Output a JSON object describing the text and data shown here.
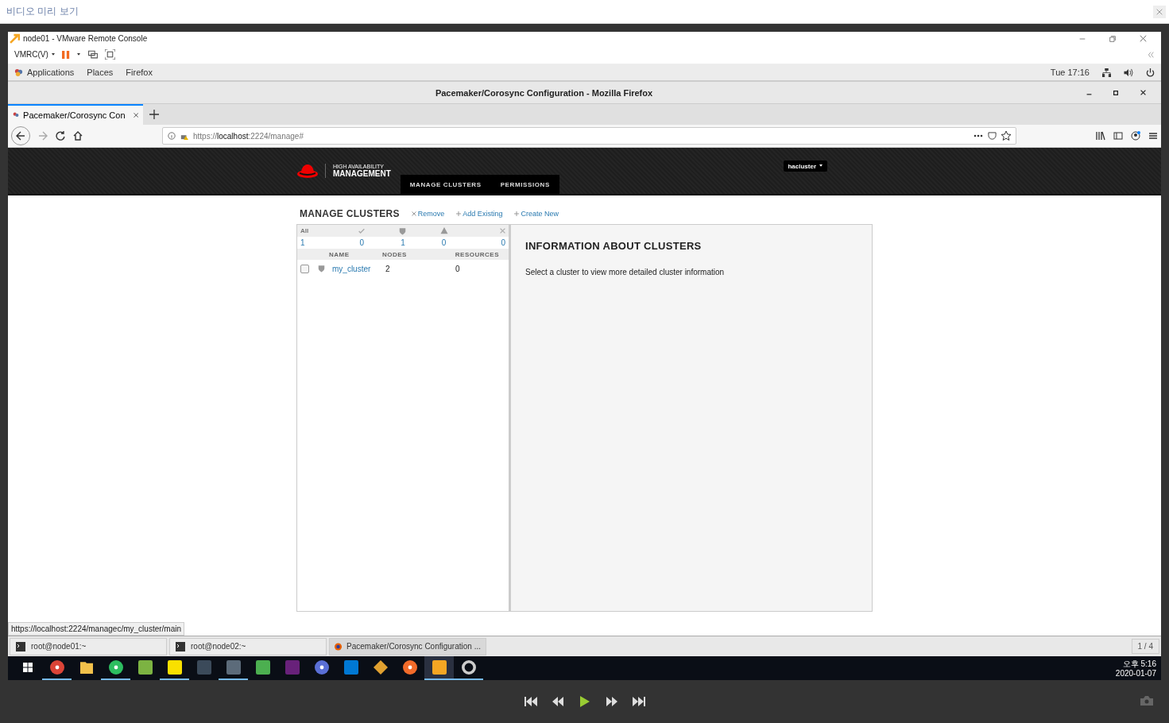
{
  "preview": {
    "title": "비디오 미리 보기"
  },
  "vmrc": {
    "title": "node01 - VMware Remote Console",
    "menu": "VMRC(V)",
    "paused": true
  },
  "gnome": {
    "menus": [
      "Applications",
      "Places",
      "Firefox"
    ],
    "clock": "Tue 17:16"
  },
  "firefox": {
    "title": "Pacemaker/Corosync Configuration - Mozilla Firefox",
    "tabs": [
      {
        "label": "Pacemaker/Corosync Con",
        "selected": true
      }
    ],
    "url": {
      "scheme": "https://",
      "host": "localhost",
      "rest": ":2224/manage#"
    }
  },
  "app": {
    "brand_top": "HIGH AVAILABILITY",
    "brand_bottom": "MANAGEMENT",
    "nav": [
      {
        "label": "MANAGE CLUSTERS",
        "selected": false
      },
      {
        "label": "PERMISSIONS",
        "selected": false
      }
    ],
    "user": "hacluster",
    "heading": "MANAGE CLUSTERS",
    "actions": [
      {
        "kind": "remove",
        "label": "Remove"
      },
      {
        "kind": "add",
        "label": "Add Existing"
      },
      {
        "kind": "add",
        "label": "Create New"
      }
    ],
    "filters": [
      {
        "kind": "all",
        "label": "All",
        "count": "1"
      },
      {
        "kind": "ok",
        "count": "0"
      },
      {
        "kind": "shield",
        "count": "1"
      },
      {
        "kind": "warning",
        "count": "0"
      },
      {
        "kind": "error",
        "count": "0"
      }
    ],
    "columns": [
      "NAME",
      "NODES",
      "RESOURCES"
    ],
    "rows": [
      {
        "checked": false,
        "name": "my_cluster",
        "nodes": "2",
        "resources": "0"
      }
    ],
    "info_title": "INFORMATION ABOUT CLUSTERS",
    "info_text": "Select a cluster to view more detailed cluster information"
  },
  "status_url": "https://localhost:2224/managec/my_cluster/main",
  "window_list": {
    "items": [
      {
        "kind": "terminal",
        "label": "root@node01:~",
        "selected": false
      },
      {
        "kind": "terminal",
        "label": "root@node02:~",
        "selected": false
      },
      {
        "kind": "browser",
        "label": "Pacemaker/Corosync Configuration ...",
        "selected": true
      }
    ],
    "pager": "1 / 4"
  },
  "taskbar": {
    "apps": [
      {
        "kind": "round",
        "color": "#db4437",
        "running": true,
        "selected": false
      },
      {
        "kind": "folder",
        "color": "#f3c14b",
        "running": false,
        "selected": false
      },
      {
        "kind": "round",
        "color": "#2dbe60",
        "running": true,
        "selected": false
      },
      {
        "kind": "tile",
        "color": "#7cb342",
        "running": false,
        "selected": false
      },
      {
        "kind": "tile",
        "color": "#f9e000",
        "running": true,
        "selected": false
      },
      {
        "kind": "tile",
        "color": "#3b4a5a",
        "running": false,
        "selected": false
      },
      {
        "kind": "tile",
        "color": "#5c6b7a",
        "running": true,
        "selected": false
      },
      {
        "kind": "tile",
        "color": "#4caf50",
        "running": false,
        "selected": false
      },
      {
        "kind": "tile",
        "color": "#68217a",
        "running": false,
        "selected": false
      },
      {
        "kind": "round",
        "color": "#5a6fd6",
        "running": false,
        "selected": false
      },
      {
        "kind": "tile",
        "color": "#0078d4",
        "running": false,
        "selected": false
      },
      {
        "kind": "diamond",
        "color": "#e0a030",
        "running": false,
        "selected": false
      },
      {
        "kind": "round",
        "color": "#f26b2a",
        "running": false,
        "selected": false
      },
      {
        "kind": "tile",
        "color": "#f5a623",
        "running": true,
        "selected": true
      },
      {
        "kind": "ring",
        "color": "#cccccc",
        "running": true,
        "selected": false
      }
    ],
    "time": "오후 5:16",
    "date": "2020-01-07"
  }
}
